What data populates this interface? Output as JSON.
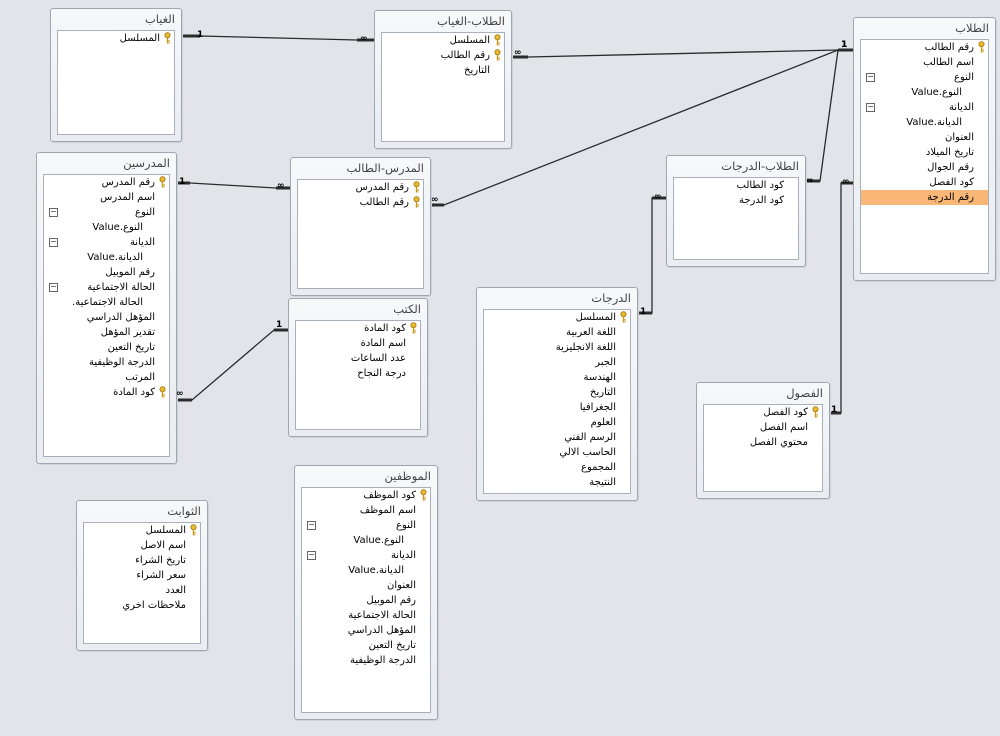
{
  "tables": [
    {
      "id": "absence",
      "title": "الغياب",
      "fields": [
        {
          "label": "المسلسل",
          "key": true
        }
      ]
    },
    {
      "id": "students_absence",
      "title": "الطلاب-الغياب",
      "fields": [
        {
          "label": "المسلسل",
          "key": true
        },
        {
          "label": "رقم الطالب",
          "key": true
        },
        {
          "label": "التاريخ"
        }
      ]
    },
    {
      "id": "students",
      "title": "الطلاب",
      "fields": [
        {
          "label": "رقم الطالب",
          "key": true
        },
        {
          "label": "اسم الطالب"
        },
        {
          "label": "النوع",
          "expander": "−"
        },
        {
          "label": "النوع.Value",
          "sub": true
        },
        {
          "label": "الديانة",
          "expander": "−"
        },
        {
          "label": "الديانة.Value",
          "sub": true
        },
        {
          "label": "العنوان"
        },
        {
          "label": "تاريخ الميلاد"
        },
        {
          "label": "رقم الجوال"
        },
        {
          "label": "كود الفصل"
        },
        {
          "label": "رقم الدرجة",
          "selected": true
        }
      ]
    },
    {
      "id": "teachers",
      "title": "المدرسين",
      "fields": [
        {
          "label": "رقم المدرس",
          "key": true
        },
        {
          "label": "اسم المدرس"
        },
        {
          "label": "النوع",
          "expander": "−"
        },
        {
          "label": "النوع.Value",
          "sub": true
        },
        {
          "label": "الديانة",
          "expander": "−"
        },
        {
          "label": "الديانة.Value",
          "sub": true
        },
        {
          "label": "رقم الموبيل"
        },
        {
          "label": "الحالة الاجتماعية",
          "expander": "−"
        },
        {
          "label": "الحالة الاجتماعية.",
          "sub": true
        },
        {
          "label": "المؤهل الدراسي"
        },
        {
          "label": "تقدير المؤهل"
        },
        {
          "label": "تاريخ التعين"
        },
        {
          "label": "الدرجة الوظيفية"
        },
        {
          "label": "المرتب"
        },
        {
          "label": "كود المادة",
          "key": true
        }
      ]
    },
    {
      "id": "teacher_student",
      "title": "المدرس-الطالب",
      "fields": [
        {
          "label": "رقم المدرس",
          "key": true
        },
        {
          "label": "رقم الطالب",
          "key": true
        }
      ]
    },
    {
      "id": "students_grades",
      "title": "الطلاب-الدرجات",
      "fields": [
        {
          "label": "كود الطالب"
        },
        {
          "label": "كود الدرجة"
        }
      ]
    },
    {
      "id": "books",
      "title": "الكتب",
      "fields": [
        {
          "label": "كود المادة",
          "key": true
        },
        {
          "label": "اسم المادة"
        },
        {
          "label": "عدد الساعات"
        },
        {
          "label": "درجة النجاح"
        }
      ]
    },
    {
      "id": "grades",
      "title": "الدرجات",
      "fields": [
        {
          "label": "المسلسل",
          "key": true
        },
        {
          "label": "اللغة العربية"
        },
        {
          "label": "اللغة الانجليزية"
        },
        {
          "label": "الجبر"
        },
        {
          "label": "الهندسة"
        },
        {
          "label": "التاريخ"
        },
        {
          "label": "الجغرافيا"
        },
        {
          "label": "العلوم"
        },
        {
          "label": "الرسم الفني"
        },
        {
          "label": "الحاسب الالي"
        },
        {
          "label": "المجموع"
        },
        {
          "label": "النتيجة"
        }
      ]
    },
    {
      "id": "classes",
      "title": "الفصول",
      "fields": [
        {
          "label": "كود الفصل",
          "key": true
        },
        {
          "label": "اسم الفصل"
        },
        {
          "label": "محتوي الفصل"
        }
      ]
    },
    {
      "id": "employees",
      "title": "الموظفين",
      "fields": [
        {
          "label": "كود الموظف",
          "key": true
        },
        {
          "label": "اسم الموظف"
        },
        {
          "label": "النوع",
          "expander": "−"
        },
        {
          "label": "النوع.Value",
          "sub": true
        },
        {
          "label": "الديانة",
          "expander": "−"
        },
        {
          "label": "الديانة.Value",
          "sub": true
        },
        {
          "label": "العنوان"
        },
        {
          "label": "رقم الموبيل"
        },
        {
          "label": "الحالة الاجتماعية"
        },
        {
          "label": "المؤهل الدراسي"
        },
        {
          "label": "تاريخ التعين"
        },
        {
          "label": "الدرجة الوظيفية"
        }
      ]
    },
    {
      "id": "constants",
      "title": "الثوابت",
      "fields": [
        {
          "label": "المسلسل",
          "key": true
        },
        {
          "label": "اسم الاصل"
        },
        {
          "label": "تاريخ الشراء"
        },
        {
          "label": "سعر الشراء"
        },
        {
          "label": "العدد"
        },
        {
          "label": "ملاحظات اخري"
        }
      ]
    }
  ],
  "relationships": [
    {
      "from": "absence",
      "to": "students_absence",
      "from_card": "1",
      "to_card": "∞"
    },
    {
      "from": "students",
      "to": "students_absence",
      "from_card": "1",
      "to_card": "∞"
    },
    {
      "from": "teachers",
      "to": "teacher_student",
      "from_card": "1",
      "to_card": "∞"
    },
    {
      "from": "students",
      "to": "teacher_student",
      "from_card": "1",
      "to_card": "∞"
    },
    {
      "from": "students",
      "to": "students_grades",
      "from_card": "1",
      "to_card": "∞"
    },
    {
      "from": "grades",
      "to": "students_grades",
      "from_card": "1",
      "to_card": "∞"
    },
    {
      "from": "books",
      "to": "teachers",
      "from_card": "1",
      "to_card": "∞"
    },
    {
      "from": "classes",
      "to": "students",
      "from_card": "1",
      "to_card": "∞"
    }
  ],
  "colors": {
    "selected_row": "#f8b677",
    "line": "#2b2b2b",
    "key_icon": "#d9a520"
  }
}
